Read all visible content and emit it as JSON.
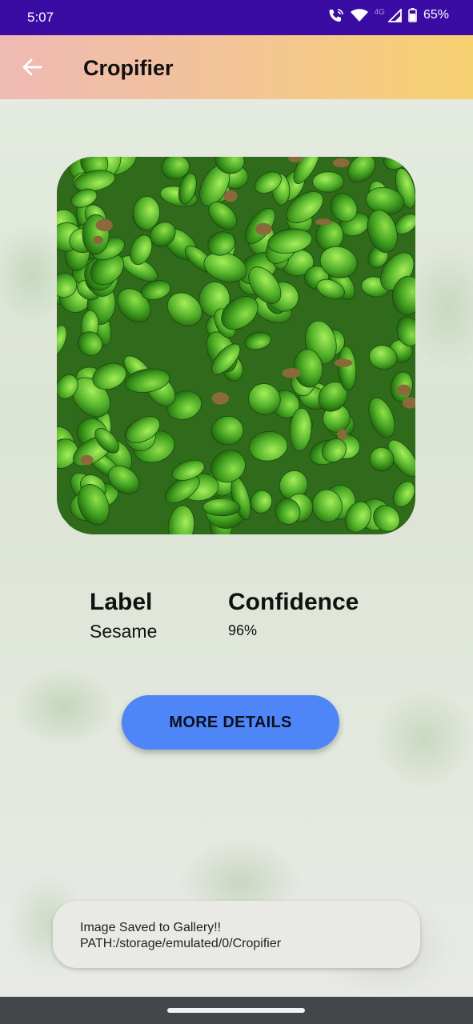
{
  "status_bar": {
    "time": "5:07",
    "network": "4G",
    "battery": "65%",
    "icons": [
      "wifi-calling-icon",
      "wifi-icon",
      "signal-icon",
      "battery-icon"
    ]
  },
  "app_bar": {
    "title": "Cropifier",
    "back_icon": "arrow-left-icon"
  },
  "photo": {
    "description_icon": "crop-photo-icon"
  },
  "result": {
    "label_heading": "Label",
    "label_value": "Sesame",
    "confidence_heading": "Confidence",
    "confidence_value": "96%"
  },
  "actions": {
    "more_details_label": "MORE DETAILS"
  },
  "toast": {
    "message": "Image Saved to Gallery!!  PATH:/storage/emulated/0/Cropifier"
  },
  "colors": {
    "status_bar": "#3a0ca3",
    "button": "#4f86f7",
    "app_bar_start": "#efb9b4",
    "app_bar_end": "#f7d06f"
  }
}
